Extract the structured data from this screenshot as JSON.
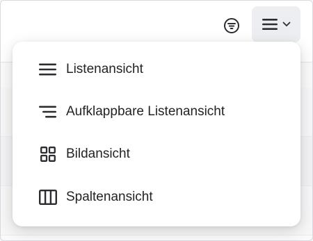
{
  "toolbar": {
    "filter_icon": "filter-circle-icon",
    "view_icon": "hamburger-menu-icon",
    "chevron_icon": "chevron-down-icon"
  },
  "view_menu": {
    "items": [
      {
        "label": "Listenansicht",
        "icon": "list-icon"
      },
      {
        "label": "Aufklappbare Listenansicht",
        "icon": "expandable-list-icon"
      },
      {
        "label": "Bildansicht",
        "icon": "grid-icon"
      },
      {
        "label": "Spaltenansicht",
        "icon": "columns-icon"
      }
    ]
  },
  "colors": {
    "icon": "#2b2c30",
    "text": "#222326",
    "button_bg": "#eceef1",
    "menu_bg": "#ffffff"
  }
}
